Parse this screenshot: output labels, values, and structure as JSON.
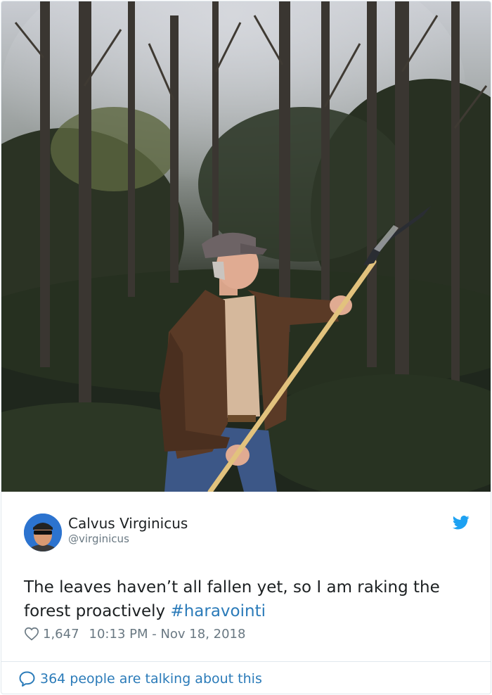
{
  "tweet": {
    "display_name": "Calvus Virginicus",
    "handle": "@virginicus",
    "text_before_hashtag": "The leaves haven’t all fallen yet, so I am raking the forest proactively ",
    "hashtag": "#haravointi",
    "likes": "1,647",
    "timestamp": "10:13 PM - Nov 18, 2018",
    "conversation": "364 people are talking about this"
  },
  "icons": {
    "platform_logo": "twitter-bird-icon",
    "like": "heart-icon",
    "reply": "speech-bubble-icon"
  },
  "colors": {
    "link": "#2b7bb9",
    "twitter_blue": "#1da1f2",
    "muted_text": "#697882",
    "border": "#e1e8ed"
  }
}
